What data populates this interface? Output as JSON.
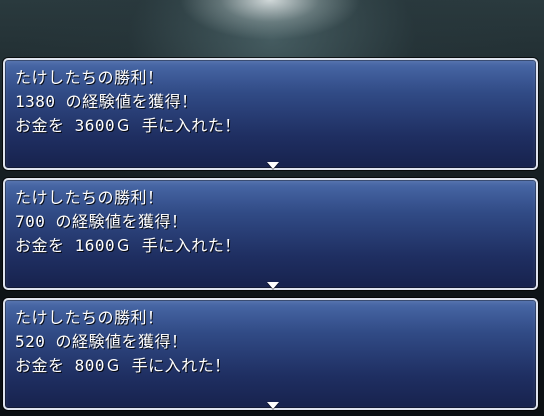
{
  "messages": [
    {
      "lines": [
        "たけしたちの勝利！",
        "1380 の経験値を獲得！",
        "お金を 3600Ｇ 手に入れた！"
      ]
    },
    {
      "lines": [
        "たけしたちの勝利！",
        "700 の経験値を獲得！",
        "お金を 1600Ｇ 手に入れた！"
      ]
    },
    {
      "lines": [
        "たけしたちの勝利！",
        "520 の経験値を獲得！",
        "お金を 800Ｇ 手に入れた！"
      ]
    }
  ],
  "cursor_icon": "down-triangle-icon"
}
